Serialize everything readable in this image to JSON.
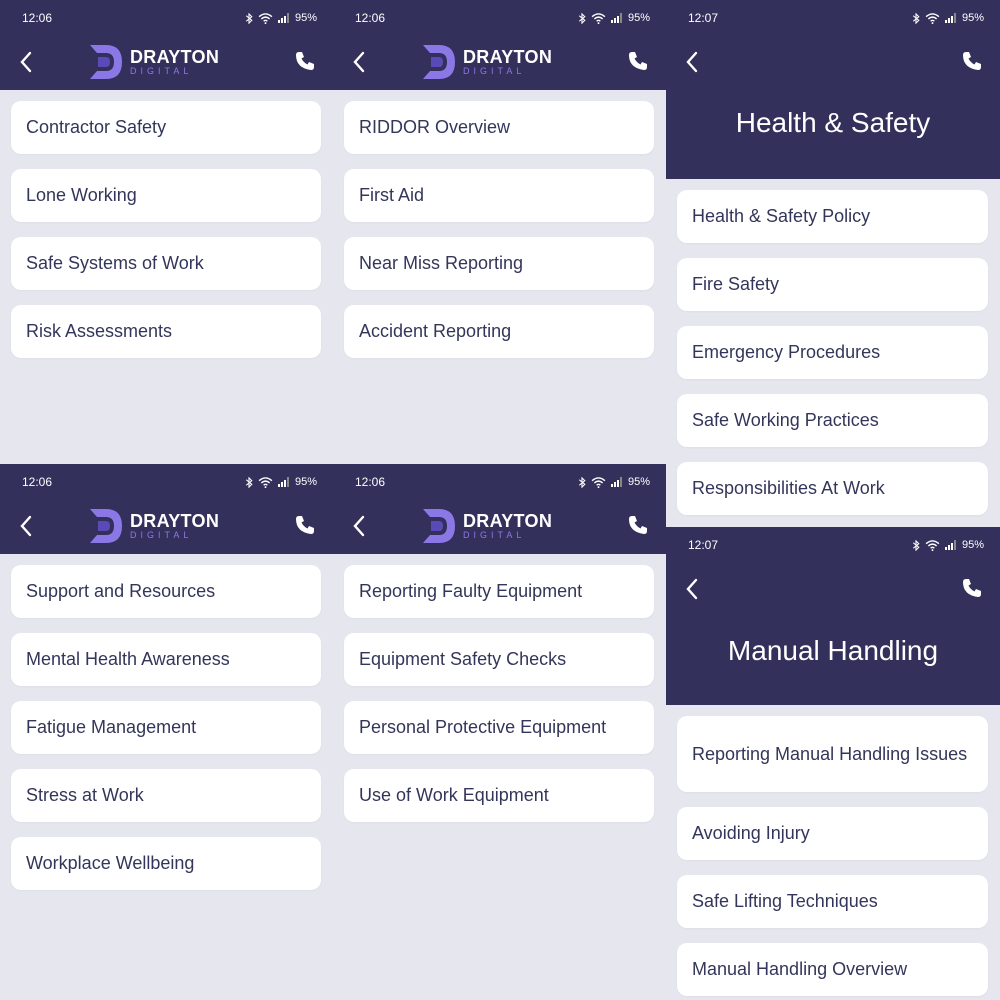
{
  "screens": [
    {
      "status": {
        "time": "12:06",
        "battery": "95%"
      },
      "logo": {
        "main": "DRAYTON",
        "sub": "DIGITAL"
      },
      "items": [
        "Contractor Safety",
        "Lone Working",
        "Safe Systems of Work",
        "Risk Assessments"
      ]
    },
    {
      "status": {
        "time": "12:06",
        "battery": "95%"
      },
      "logo": {
        "main": "DRAYTON",
        "sub": "DIGITAL"
      },
      "items": [
        "RIDDOR Overview",
        "First Aid",
        "Near Miss Reporting",
        "Accident Reporting"
      ]
    },
    {
      "status": {
        "time": "12:07",
        "battery": "95%"
      },
      "title": "Health & Safety",
      "items": [
        "Health & Safety Policy",
        "Fire Safety",
        "Emergency Procedures",
        "Safe Working Practices",
        "Responsibilities At Work"
      ]
    },
    {
      "status": {
        "time": "12:06",
        "battery": "95%"
      },
      "logo": {
        "main": "DRAYTON",
        "sub": "DIGITAL"
      },
      "items": [
        "Support and Resources",
        "Mental Health Awareness",
        "Fatigue Management",
        "Stress at Work",
        "Workplace Wellbeing"
      ]
    },
    {
      "status": {
        "time": "12:06",
        "battery": "95%"
      },
      "logo": {
        "main": "DRAYTON",
        "sub": "DIGITAL"
      },
      "items": [
        "Reporting Faulty Equipment",
        "Equipment Safety Checks",
        "Personal Protective Equipment",
        "Use of Work Equipment"
      ]
    },
    {
      "status": {
        "time": "12:07",
        "battery": "95%"
      },
      "title": "Manual Handling",
      "items": [
        "Reporting Manual Handling Issues",
        "Avoiding Injury",
        "Safe Lifting Techniques",
        "Manual Handling Overview"
      ]
    }
  ],
  "icons": {
    "back": "chevron-left-icon",
    "phone": "phone-icon",
    "bluetooth": "bluetooth-icon",
    "wifi": "wifi-icon",
    "signal": "signal-icon"
  },
  "colors": {
    "header": "#34305c",
    "background": "#e6e7ee",
    "card": "#ffffff",
    "text": "#33365a",
    "logo_accent": "#8b78e6"
  }
}
